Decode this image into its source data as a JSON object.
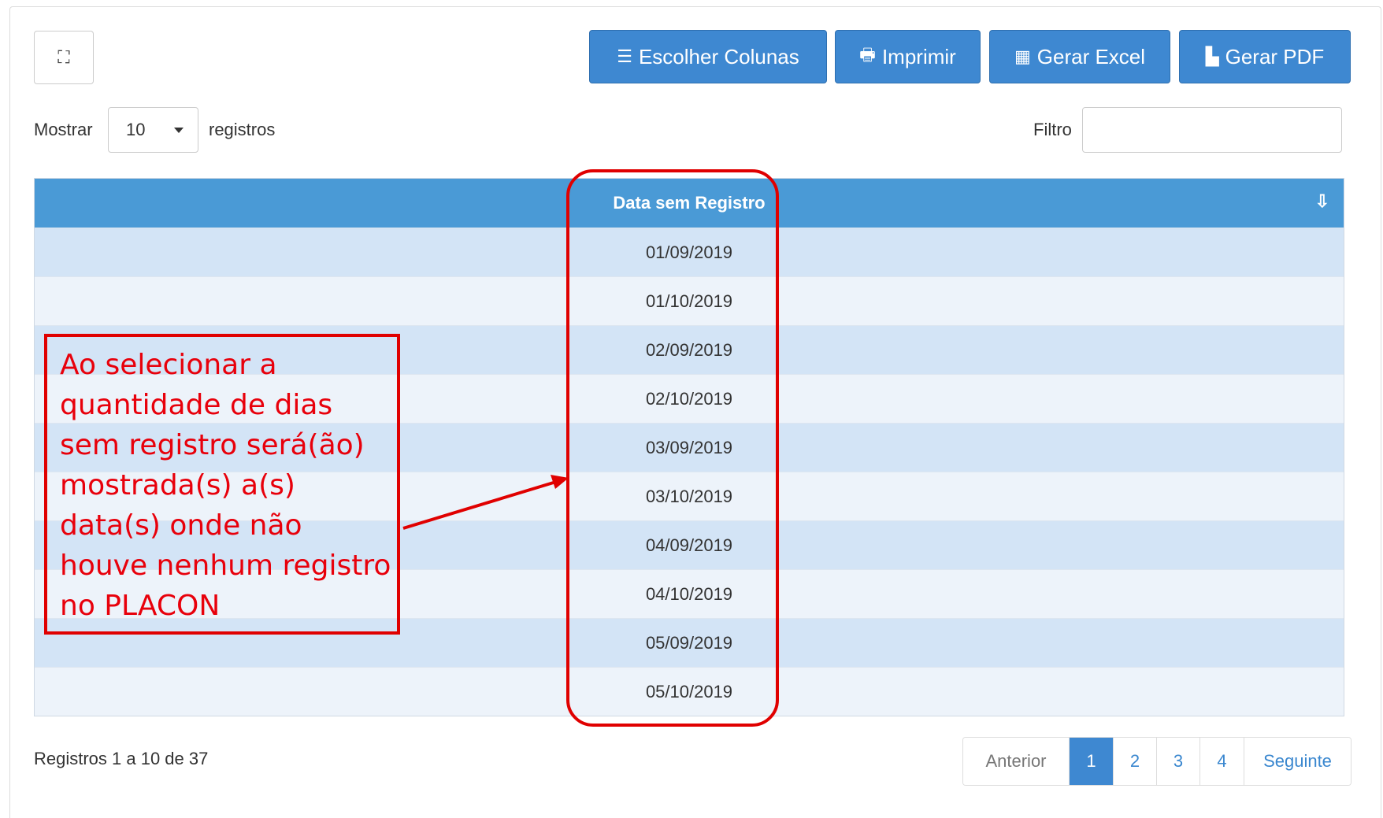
{
  "toolbar": {
    "expand_icon": "expand-icon",
    "buttons": [
      {
        "label": "Escolher Colunas",
        "icon": "list-icon",
        "glyph": "☰"
      },
      {
        "label": "Imprimir",
        "icon": "print-icon",
        "glyph": "🖶"
      },
      {
        "label": "Gerar Excel",
        "icon": "table-icon",
        "glyph": "▦"
      },
      {
        "label": "Gerar PDF",
        "icon": "file-icon",
        "glyph": "▙"
      }
    ]
  },
  "length": {
    "prefix": "Mostrar",
    "value": "10",
    "suffix": "registros"
  },
  "filter": {
    "label": "Filtro",
    "value": ""
  },
  "table": {
    "column_header": "Data sem Registro",
    "rows": [
      "01/09/2019",
      "01/10/2019",
      "02/09/2019",
      "02/10/2019",
      "03/09/2019",
      "03/10/2019",
      "04/09/2019",
      "04/10/2019",
      "05/09/2019",
      "05/10/2019"
    ]
  },
  "footer": {
    "info": "Registros 1 a 10 de 37"
  },
  "pagination": {
    "previous": "Anterior",
    "pages": [
      "1",
      "2",
      "3",
      "4"
    ],
    "active_page": "1",
    "next": "Seguinte"
  },
  "annotation": {
    "text": "Ao selecionar a quantidade de dias sem registro será(ão) mostrada(s) a(s) data(s) onde não houve nenhum registro no PLACON",
    "color": "#e8000b"
  },
  "colors": {
    "primary": "#3e88d1",
    "header": "#4a9ad6",
    "row_odd": "#d3e4f6",
    "row_even": "#edf3fa"
  }
}
